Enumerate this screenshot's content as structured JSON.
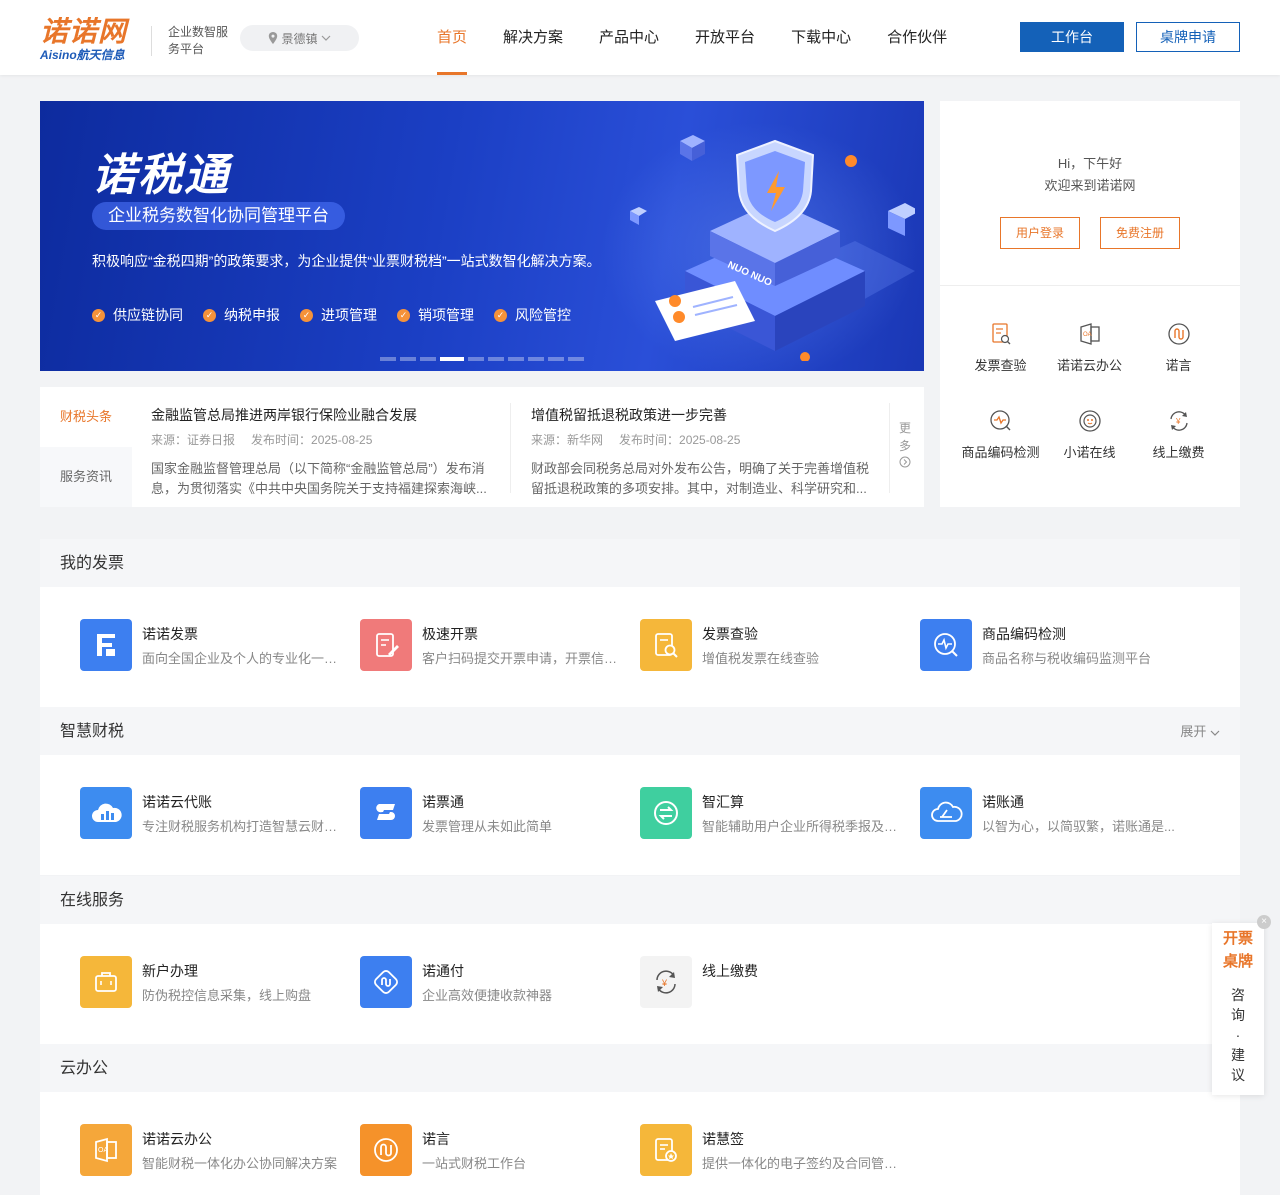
{
  "header": {
    "logo_main": "诺诺网",
    "logo_sub": "Aisino航天信息",
    "platform_name": "企业数智服务平台",
    "location": "景德镇",
    "nav": [
      "首页",
      "解决方案",
      "产品中心",
      "开放平台",
      "下载中心",
      "合作伙伴"
    ],
    "active_nav": "首页",
    "btn_workbench": "工作台",
    "btn_apply": "桌牌申请"
  },
  "banner": {
    "title": "诺税通",
    "subtitle": "企业税务数智化协同管理平台",
    "description": "积极响应“金税四期”的政策要求，为企业提供“业票财税档”一站式数智化解决方案。",
    "features": [
      "供应链协同",
      "纳税申报",
      "进项管理",
      "销项管理",
      "风险管控"
    ],
    "slide_count": 10,
    "active_slide": 4,
    "art_badge": "NUO NUO"
  },
  "login_card": {
    "greeting_line1": "Hi，下午好",
    "greeting_line2": "欢迎来到诺诺网",
    "login_button": "用户登录",
    "register_button": "免费注册",
    "quick_links": [
      {
        "label": "发票查验",
        "icon": "invoice-check-icon"
      },
      {
        "label": "诺诺云办公",
        "icon": "cloud-office-icon"
      },
      {
        "label": "诺言",
        "icon": "nuoyan-icon"
      },
      {
        "label": "商品编码检测",
        "icon": "code-detect-icon"
      },
      {
        "label": "小诺在线",
        "icon": "chat-bot-icon"
      },
      {
        "label": "线上缴费",
        "icon": "payment-icon"
      }
    ]
  },
  "news": {
    "tabs": [
      "财税头条",
      "服务资讯"
    ],
    "active_tab": "财税头条",
    "items": [
      {
        "title": "金融监管总局推进两岸银行保险业融合发展",
        "source": "来源：证券日报",
        "time": "发布时间：2025-08-25",
        "summary": "国家金融监督管理总局（以下简称“金融监管总局”）发布消息，为贯彻落实《中共中央国务院关于支持福建探索海峡..."
      },
      {
        "title": "增值税留抵退税政策进一步完善",
        "source": "来源：新华网",
        "time": "发布时间：2025-08-25",
        "summary": "财政部会同税务总局对外发布公告，明确了关于完善增值税留抵退税政策的多项安排。其中，对制造业、科学研究和..."
      }
    ],
    "more": "更多"
  },
  "sections": [
    {
      "title": "我的发票",
      "expand": "",
      "apps": [
        {
          "name": "诺诺发票",
          "desc": "面向全国企业及个人的专业化一站式...",
          "color": "#3d7ff0",
          "icon": "nuonuo-invoice-icon"
        },
        {
          "name": "极速开票",
          "desc": "客户扫码提交开票申请，开票信息...",
          "color": "#f07a7a",
          "icon": "fast-invoice-icon"
        },
        {
          "name": "发票查验",
          "desc": "增值税发票在线查验",
          "color": "#f5b73a",
          "icon": "invoice-verify-icon"
        },
        {
          "name": "商品编码检测",
          "desc": "商品名称与税收编码监测平台",
          "color": "#3d7ff0",
          "icon": "code-monitor-icon"
        }
      ]
    },
    {
      "title": "智慧财税",
      "expand": "展开",
      "apps": [
        {
          "name": "诺诺云代账",
          "desc": "专注财税服务机构打造智慧云财务...",
          "color": "#3d8cf0",
          "icon": "cloud-accounting-icon"
        },
        {
          "name": "诺票通",
          "desc": "发票管理从未如此简单",
          "color": "#3d7ff0",
          "icon": "nuopiaotong-icon"
        },
        {
          "name": "智汇算",
          "desc": "智能辅助用户企业所得税季报及年报...",
          "color": "#3fcf9f",
          "icon": "zhihuisuan-icon"
        },
        {
          "name": "诺账通",
          "desc": "以智为心，以简驭繁，诺账通是...",
          "color": "#3d8cf0",
          "icon": "nuozhangtong-icon"
        }
      ]
    },
    {
      "title": "在线服务",
      "expand": "",
      "apps": [
        {
          "name": "新户办理",
          "desc": "防伪税控信息采集，线上购盘",
          "color": "#f5b73a",
          "icon": "new-account-icon"
        },
        {
          "name": "诺通付",
          "desc": "企业高效便捷收款神器",
          "color": "#3d7ff0",
          "icon": "nuotongfu-icon"
        },
        {
          "name": "线上缴费",
          "desc": "",
          "color": "#f3f3f3",
          "icon": "online-payment-icon"
        }
      ]
    },
    {
      "title": "云办公",
      "expand": "",
      "apps": [
        {
          "name": "诺诺云办公",
          "desc": "智能财税一体化办公协同解决方案",
          "color": "#f5a73a",
          "icon": "cloud-office-app-icon"
        },
        {
          "name": "诺言",
          "desc": "一站式财税工作台",
          "color": "#f5922a",
          "icon": "nuoyan-app-icon"
        },
        {
          "name": "诺慧签",
          "desc": "提供一体化的电子签约及合同管理...",
          "color": "#f5b73a",
          "icon": "nuohuiqian-icon"
        }
      ]
    }
  ],
  "float_widget": {
    "top_line1": "开票",
    "top_line2": "桌牌",
    "sub_text": "咨询·建议",
    "close": "×"
  }
}
